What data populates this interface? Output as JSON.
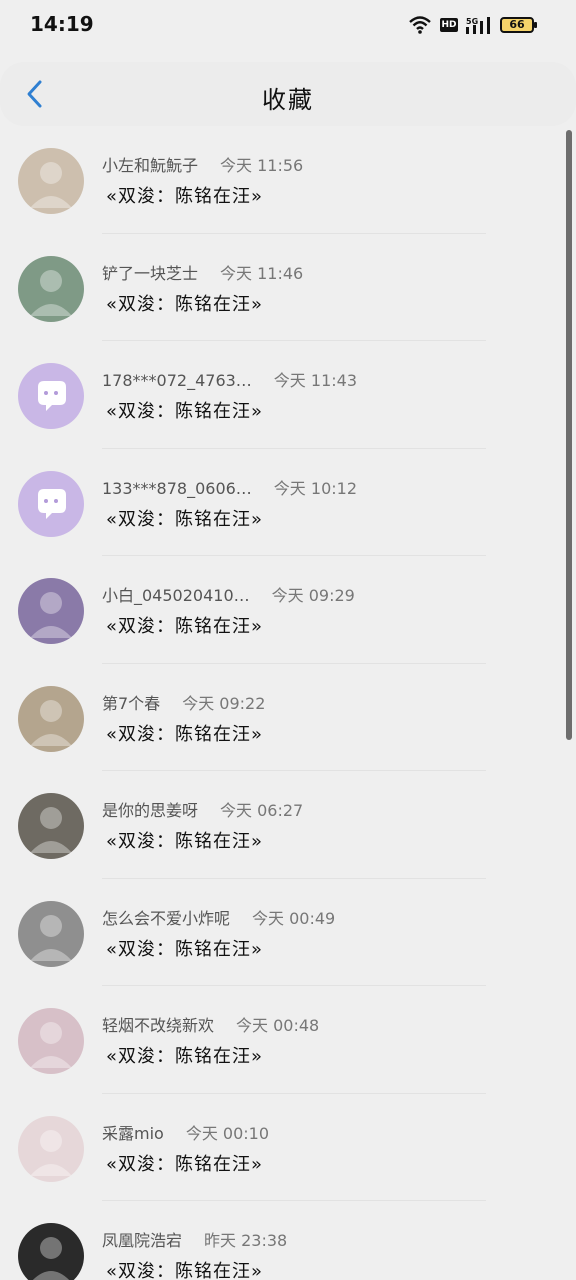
{
  "status": {
    "time": "14:19",
    "hd": "HD",
    "network": "5G",
    "battery": "66"
  },
  "header": {
    "title": "收藏"
  },
  "items": [
    {
      "name": "小左和魭魭子",
      "time": "今天 11:56",
      "message": "«双浚：陈铭在汪»",
      "avatar_color": "#cdbfae"
    },
    {
      "name": "铲了一块芝士",
      "time": "今天 11:46",
      "message": "«双浚：陈铭在汪»",
      "avatar_color": "#7f9a86"
    },
    {
      "name": "178***072_4763…",
      "time": "今天 11:43",
      "message": "«双浚：陈铭在汪»",
      "avatar_color": "#c9b7e6"
    },
    {
      "name": "133***878_0606…",
      "time": "今天 10:12",
      "message": "«双浚：陈铭在汪»",
      "avatar_color": "#c9b7e6"
    },
    {
      "name": "小白_045020410…",
      "time": "今天 09:29",
      "message": "«双浚：陈铭在汪»",
      "avatar_color": "#8a7aa8"
    },
    {
      "name": "第7个春",
      "time": "今天 09:22",
      "message": "«双浚：陈铭在汪»",
      "avatar_color": "#b4a58e"
    },
    {
      "name": "是你的思姜呀",
      "time": "今天 06:27",
      "message": "«双浚：陈铭在汪»",
      "avatar_color": "#6e6a62"
    },
    {
      "name": "怎么会不爱小炸呢",
      "time": "今天 00:49",
      "message": "«双浚：陈铭在汪»",
      "avatar_color": "#8f8f8f"
    },
    {
      "name": "轻烟不改绕新欢",
      "time": "今天 00:48",
      "message": "«双浚：陈铭在汪»",
      "avatar_color": "#d7c0c8"
    },
    {
      "name": "采露mio",
      "time": "今天 00:10",
      "message": "«双浚：陈铭在汪»",
      "avatar_color": "#e6d7d9"
    },
    {
      "name": "凤凰院浩宕",
      "time": "昨天 23:38",
      "message": "«双浚：陈铭在汪»",
      "avatar_color": "#2a2a2a"
    }
  ]
}
